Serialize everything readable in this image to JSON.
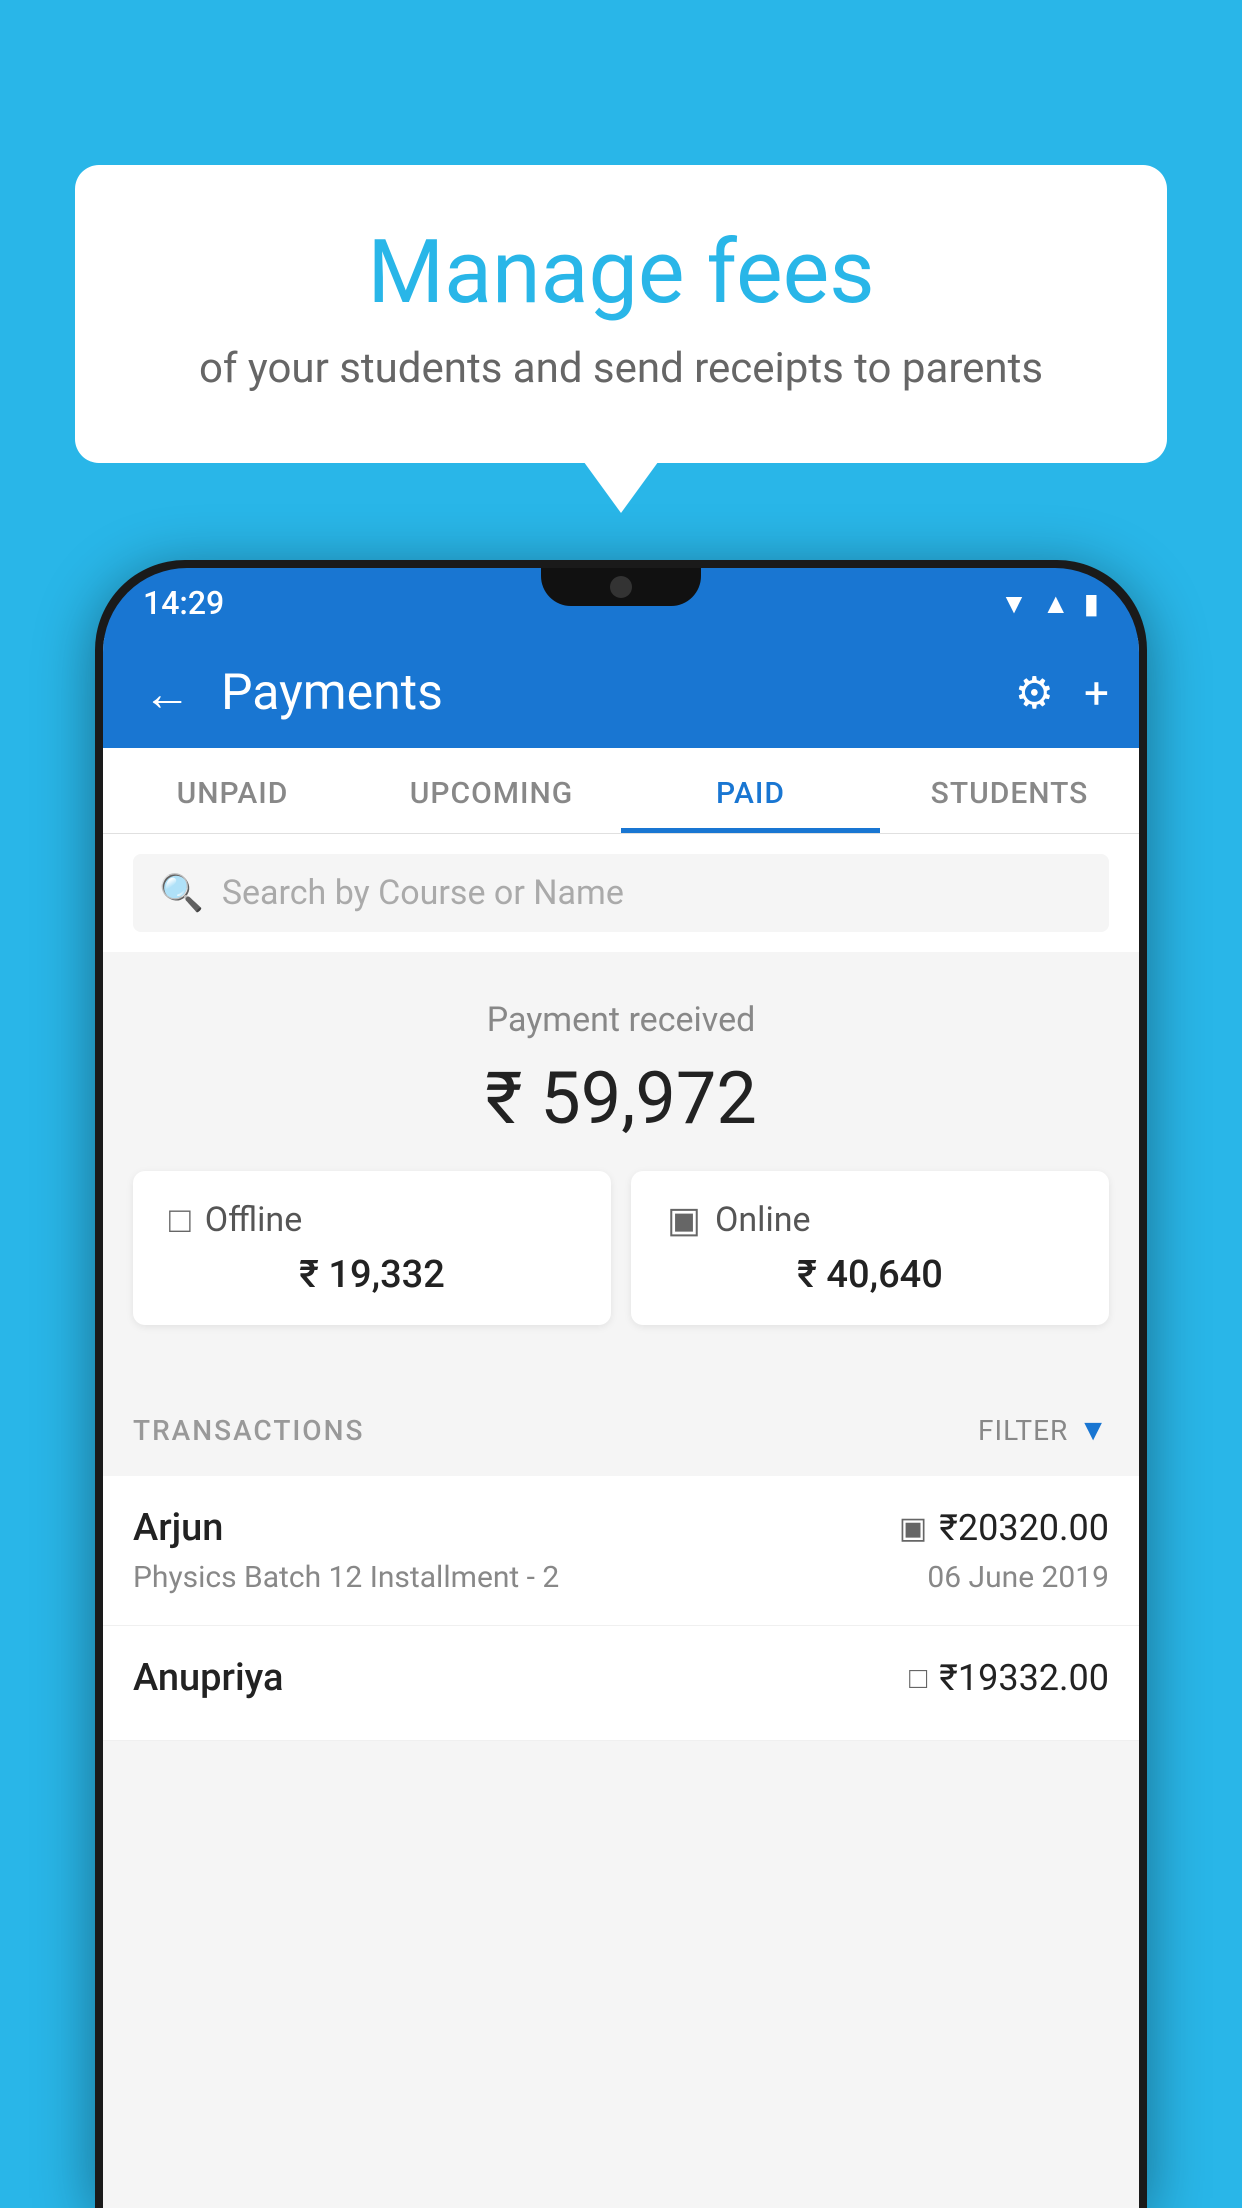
{
  "background_color": "#29b6e8",
  "speech_bubble": {
    "title": "Manage fees",
    "subtitle": "of your students and send receipts to parents"
  },
  "status_bar": {
    "time": "14:29",
    "wifi_icon": "▼",
    "signal_icon": "▲",
    "battery_icon": "▮"
  },
  "app_bar": {
    "title": "Payments",
    "back_label": "←",
    "gear_label": "⚙",
    "plus_label": "+"
  },
  "tabs": [
    {
      "label": "UNPAID",
      "active": false
    },
    {
      "label": "UPCOMING",
      "active": false
    },
    {
      "label": "PAID",
      "active": true
    },
    {
      "label": "STUDENTS",
      "active": false
    }
  ],
  "search": {
    "placeholder": "Search by Course or Name"
  },
  "payment_summary": {
    "received_label": "Payment received",
    "total_amount": "₹ 59,972",
    "offline_label": "Offline",
    "offline_amount": "₹ 19,332",
    "online_label": "Online",
    "online_amount": "₹ 40,640"
  },
  "transactions_section": {
    "label": "TRANSACTIONS",
    "filter_label": "FILTER",
    "filter_icon": "▼"
  },
  "transactions": [
    {
      "name": "Arjun",
      "course": "Physics Batch 12 Installment - 2",
      "amount": "₹20320.00",
      "date": "06 June 2019",
      "icon": "card"
    },
    {
      "name": "Anupriya",
      "course": "",
      "amount": "₹19332.00",
      "date": "",
      "icon": "cash"
    }
  ]
}
